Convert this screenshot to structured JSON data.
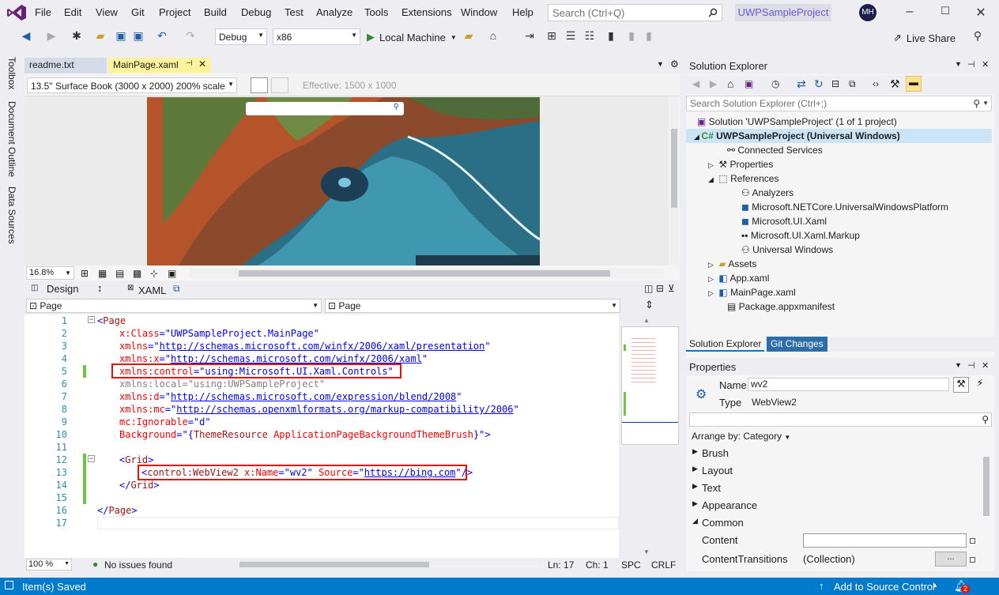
{
  "menubar": {
    "items": [
      "File",
      "Edit",
      "View",
      "Git",
      "Project",
      "Build",
      "Debug",
      "Test",
      "Analyze",
      "Tools",
      "Extensions",
      "Window",
      "Help"
    ],
    "search_placeholder": "Search (Ctrl+Q)",
    "project_name": "UWPSampleProject",
    "avatar_initials": "MH"
  },
  "toolbar": {
    "config": "Debug",
    "platform": "x86",
    "run_label": "Local Machine",
    "live_share": "Live Share"
  },
  "left_rail": [
    "Toolbox",
    "Document Outline",
    "Data Sources"
  ],
  "tabs": [
    {
      "label": "readme.txt",
      "active": false
    },
    {
      "label": "MainPage.xaml",
      "active": true
    }
  ],
  "designer": {
    "device": "13.5\" Surface Book (3000 x 2000) 200% scale",
    "effective": "Effective: 1500 x 1000",
    "zoom": "16.8%",
    "design_tab": "Design",
    "xaml_tab": "XAML",
    "swap_icon": "↕"
  },
  "navbar": {
    "left": "Page",
    "right": "Page"
  },
  "editor": {
    "line_numbers": [
      "1",
      "2",
      "3",
      "4",
      "5",
      "6",
      "7",
      "8",
      "9",
      "10",
      "11",
      "12",
      "13",
      "14",
      "15",
      "16",
      "17"
    ],
    "zoom": "100 %",
    "issues": "No issues found",
    "ln": "Ln: 17",
    "ch": "Ch: 1",
    "spc": "SPC",
    "crlf": "CRLF"
  },
  "solution_explorer": {
    "title": "Solution Explorer",
    "search_placeholder": "Search Solution Explorer (Ctrl+;)",
    "solution": "Solution 'UWPSampleProject' (1 of 1 project)",
    "project": "UWPSampleProject (Universal Windows)",
    "items": [
      "Connected Services",
      "Properties",
      "References",
      "Analyzers",
      "Microsoft.NETCore.UniversalWindowsPlatform",
      "Microsoft.UI.Xaml",
      "Microsoft.UI.Xaml.Markup",
      "Universal Windows",
      "Assets",
      "App.xaml",
      "MainPage.xaml",
      "Package.appxmanifest"
    ],
    "bottom_tabs": [
      "Solution Explorer",
      "Git Changes"
    ]
  },
  "properties": {
    "title": "Properties",
    "name_label": "Name",
    "name_value": "wv2",
    "type_label": "Type",
    "type_value": "WebView2",
    "arrange": "Arrange by: Category",
    "categories": [
      "Brush",
      "Layout",
      "Text",
      "Appearance",
      "Common"
    ],
    "content_label": "Content",
    "content_transitions_label": "ContentTransitions",
    "content_transitions_value": "(Collection)",
    "ellipsis": "..."
  },
  "status": {
    "left": "Item(s) Saved",
    "source_control": "Add to Source Control",
    "notif_count": "2"
  },
  "colors": {
    "accent": "#007acc",
    "vs_purple": "#68217a",
    "highlight_box": "#e51400",
    "change_green": "#6cc644"
  }
}
